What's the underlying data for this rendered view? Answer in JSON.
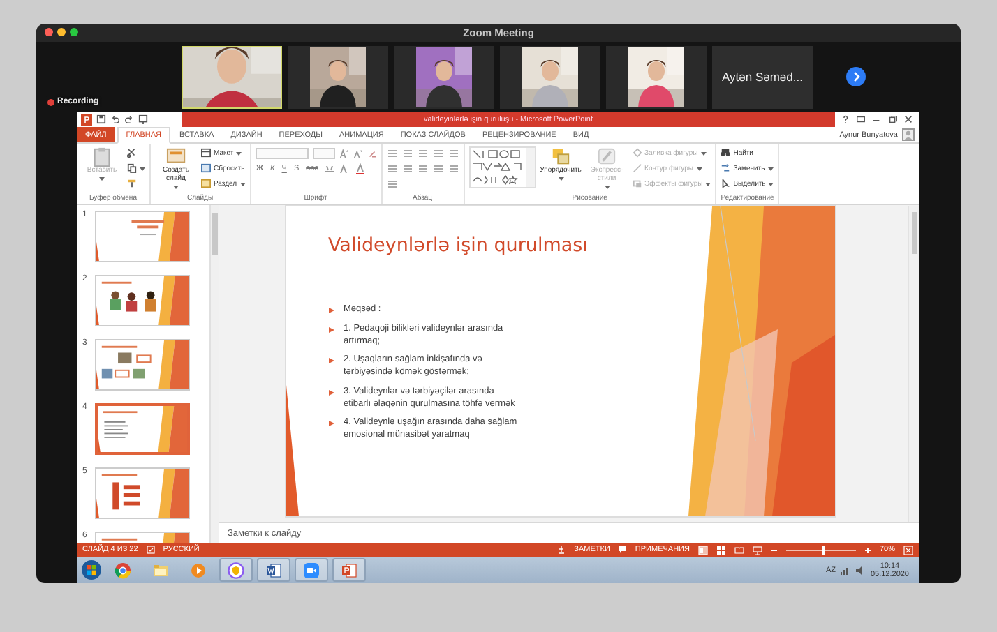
{
  "zoom": {
    "title": "Zoom Meeting",
    "recording": "Recording",
    "participants": [
      {
        "kind": "video",
        "selected": true
      },
      {
        "kind": "video",
        "selected": false
      },
      {
        "kind": "video",
        "selected": false
      },
      {
        "kind": "video",
        "selected": false
      },
      {
        "kind": "video",
        "selected": false
      },
      {
        "kind": "name",
        "name": "Aytən Səməd...",
        "selected": false
      }
    ]
  },
  "powerpoint": {
    "title": "valideyinlərlə işin quruluşu - Microsoft PowerPoint",
    "user": "Aynur Bunyatova",
    "tabs": [
      {
        "label": "ФАЙЛ",
        "kind": "file",
        "selected": false
      },
      {
        "label": "ГЛАВНАЯ",
        "kind": "tab",
        "selected": true
      },
      {
        "label": "ВСТАВКА",
        "kind": "tab",
        "selected": false
      },
      {
        "label": "ДИЗАЙН",
        "kind": "tab",
        "selected": false
      },
      {
        "label": "ПЕРЕХОДЫ",
        "kind": "tab",
        "selected": false
      },
      {
        "label": "АНИМАЦИЯ",
        "kind": "tab",
        "selected": false
      },
      {
        "label": "ПОКАЗ СЛАЙДОВ",
        "kind": "tab",
        "selected": false
      },
      {
        "label": "РЕЦЕНЗИРОВАНИЕ",
        "kind": "tab",
        "selected": false
      },
      {
        "label": "ВИД",
        "kind": "tab",
        "selected": false
      }
    ],
    "ribbon": [
      {
        "title": "Буфер обмена",
        "items": [
          {
            "kind": "paste",
            "label": "Вставить",
            "disabled": true,
            "menu": true
          },
          {
            "kind": "cut",
            "disabled": false,
            "menu": false
          },
          {
            "kind": "copy",
            "disabled": false,
            "menu": true
          },
          {
            "kind": "painter",
            "disabled": false,
            "menu": false
          }
        ]
      },
      {
        "title": "Слайды",
        "items": [
          {
            "kind": "new-slide",
            "label": "Создать слайд",
            "disabled": false,
            "menu": true
          },
          {
            "kind": "layout",
            "label": "Макет",
            "disabled": false,
            "menu": true
          },
          {
            "kind": "reset",
            "label": "Сбросить",
            "disabled": false,
            "menu": false
          },
          {
            "kind": "section",
            "label": "Раздел",
            "disabled": false,
            "menu": true
          }
        ]
      },
      {
        "title": "Шрифт",
        "items": [
          {
            "kind": "font",
            "glyphs": [
              "Ж",
              "К",
              "Ч",
              "S",
              "abc"
            ]
          }
        ]
      },
      {
        "title": "Абзац",
        "items": [
          {
            "kind": "paragraph"
          }
        ]
      },
      {
        "title": "Рисование",
        "items": [
          {
            "kind": "shapes"
          },
          {
            "kind": "arrange",
            "label": "Упорядочить",
            "disabled": false,
            "menu": true
          },
          {
            "kind": "styles",
            "label": "Экспресс-стили",
            "disabled": true,
            "menu": true
          },
          {
            "kind": "fill",
            "label": "Заливка фигуры",
            "disabled": true,
            "menu": true
          },
          {
            "kind": "outline",
            "label": "Контур фигуры",
            "disabled": true,
            "menu": true
          },
          {
            "kind": "effects",
            "label": "Эффекты фигуры",
            "disabled": true,
            "menu": true
          }
        ]
      },
      {
        "title": "Редактирование",
        "items": [
          {
            "kind": "find",
            "label": "Найти",
            "disabled": false,
            "menu": false
          },
          {
            "kind": "replace",
            "label": "Заменить",
            "disabled": false,
            "menu": true
          },
          {
            "kind": "select",
            "label": "Выделить",
            "disabled": false,
            "menu": true
          }
        ]
      }
    ],
    "thumbnails": [
      {
        "number": "1",
        "kind": "title",
        "selected": false
      },
      {
        "number": "2",
        "kind": "people",
        "selected": false
      },
      {
        "number": "3",
        "kind": "photos",
        "selected": false
      },
      {
        "number": "4",
        "kind": "text",
        "selected": true
      },
      {
        "number": "5",
        "kind": "diagram",
        "selected": false
      },
      {
        "number": "6",
        "kind": "text",
        "selected": false
      }
    ],
    "slide": {
      "title": "Valideynlərlə işin qurulması",
      "bullets": [
        "Məqsəd :",
        "1. Pedaqoji bilikləri valideynlər arasında artırmaq;",
        "2. Uşaqların sağlam inkişafında və tərbiyəsində kömək göstərmək;",
        "3. Valideynlər və tərbiyəçilər arasında etibarlı əlaqənin qurulmasına töhfə vermək",
        "4. Valideynlə uşağın arasında daha sağlam emosional münasibət yaratmaq"
      ]
    },
    "notes_placeholder": "Заметки к слайду",
    "status": {
      "slide": "СЛАЙД 4 ИЗ 22",
      "language": "РУССКИЙ",
      "notes": "ЗАМЕТКИ",
      "comments": "ПРИМЕЧАНИЯ",
      "zoom": "70%",
      "zoom_slider": {
        "level": 0.55
      }
    }
  },
  "taskbar": {
    "apps": [
      {
        "kind": "chrome",
        "running": false
      },
      {
        "kind": "folder",
        "running": false
      },
      {
        "kind": "media",
        "running": false
      },
      {
        "kind": "shield",
        "running": true
      },
      {
        "kind": "word",
        "running": true
      },
      {
        "kind": "camera",
        "running": true
      },
      {
        "kind": "powerpoint",
        "running": true
      }
    ],
    "language": "AZ",
    "time": "10:14",
    "date": "05.12.2020"
  }
}
